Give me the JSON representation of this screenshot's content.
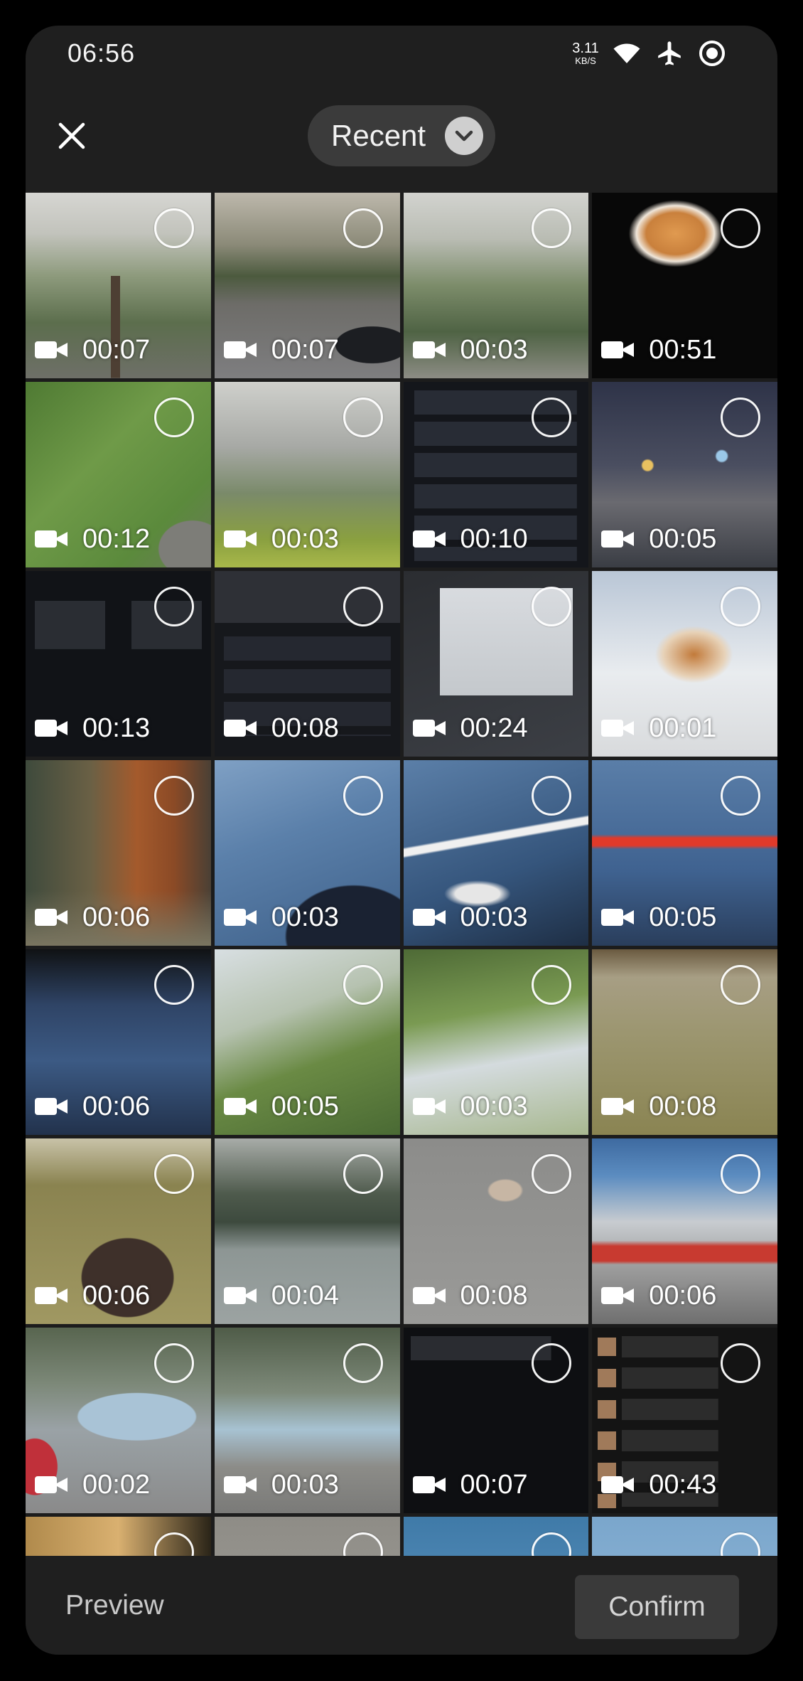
{
  "status_bar": {
    "time": "06:56",
    "net_speed_value": "3.11",
    "net_speed_unit": "KB/S",
    "icons": [
      "wifi-icon",
      "airplane-mode-icon",
      "focus-mode-icon"
    ]
  },
  "header": {
    "close_icon": "close-icon",
    "album_label": "Recent",
    "album_dropdown_icon": "chevron-down-icon"
  },
  "grid": {
    "item_icon": "video-camera-icon",
    "items": [
      {
        "duration": "00:07",
        "selected": false
      },
      {
        "duration": "00:07",
        "selected": false
      },
      {
        "duration": "00:03",
        "selected": false
      },
      {
        "duration": "00:51",
        "selected": false
      },
      {
        "duration": "00:12",
        "selected": false
      },
      {
        "duration": "00:03",
        "selected": false
      },
      {
        "duration": "00:10",
        "selected": false
      },
      {
        "duration": "00:05",
        "selected": false
      },
      {
        "duration": "00:13",
        "selected": false
      },
      {
        "duration": "00:08",
        "selected": false
      },
      {
        "duration": "00:24",
        "selected": false
      },
      {
        "duration": "00:01",
        "selected": false
      },
      {
        "duration": "00:06",
        "selected": false
      },
      {
        "duration": "00:03",
        "selected": false
      },
      {
        "duration": "00:03",
        "selected": false
      },
      {
        "duration": "00:05",
        "selected": false
      },
      {
        "duration": "00:06",
        "selected": false
      },
      {
        "duration": "00:05",
        "selected": false
      },
      {
        "duration": "00:03",
        "selected": false
      },
      {
        "duration": "00:08",
        "selected": false
      },
      {
        "duration": "00:06",
        "selected": false
      },
      {
        "duration": "00:04",
        "selected": false
      },
      {
        "duration": "00:08",
        "selected": false
      },
      {
        "duration": "00:06",
        "selected": false
      },
      {
        "duration": "00:02",
        "selected": false
      },
      {
        "duration": "00:03",
        "selected": false
      },
      {
        "duration": "00:07",
        "selected": false
      },
      {
        "duration": "00:43",
        "selected": false
      },
      {
        "selected": false
      },
      {
        "selected": false
      },
      {
        "selected": false
      },
      {
        "selected": false
      }
    ]
  },
  "footer": {
    "preview_label": "Preview",
    "confirm_label": "Confirm"
  },
  "colors": {
    "background": "#000000",
    "surface": "#1f1f1f",
    "pill": "#3b3b3b",
    "confirm_button": "#3a3a3a",
    "text": "#ffffff"
  }
}
